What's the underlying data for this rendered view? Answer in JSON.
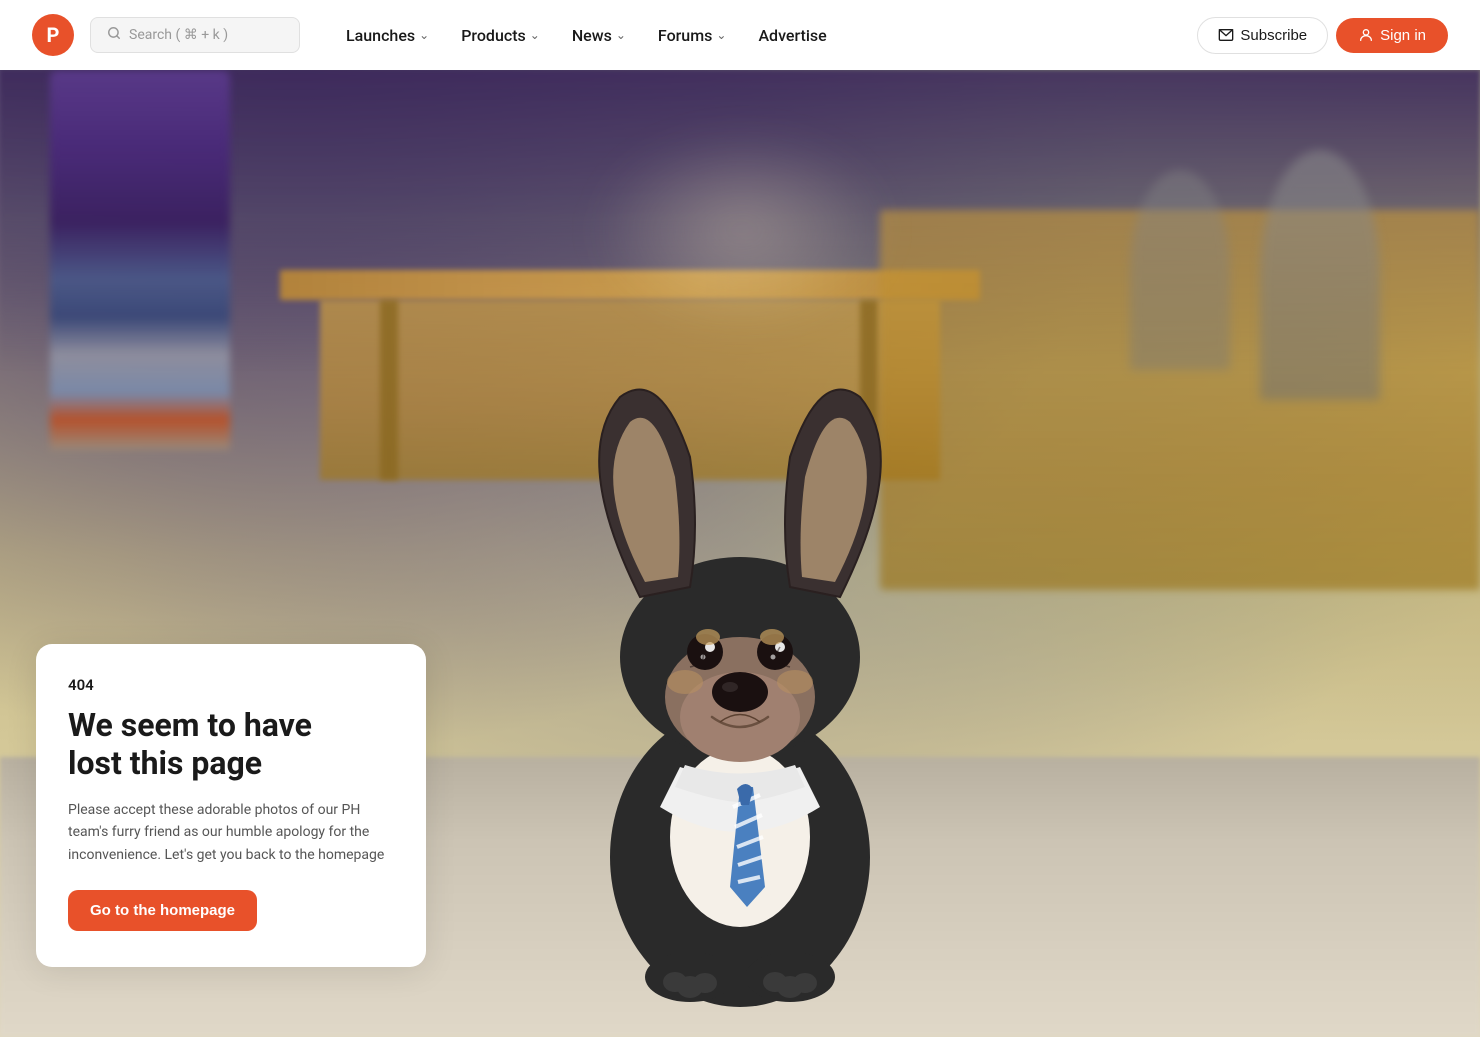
{
  "nav": {
    "logo_letter": "P",
    "search_placeholder": "Search ( ⌘ + k )",
    "links": [
      {
        "label": "Launches",
        "has_chevron": true
      },
      {
        "label": "Products",
        "has_chevron": true
      },
      {
        "label": "News",
        "has_chevron": true
      },
      {
        "label": "Forums",
        "has_chevron": true
      },
      {
        "label": "Advertise",
        "has_chevron": false
      }
    ],
    "subscribe_label": "Subscribe",
    "signin_label": "Sign in"
  },
  "error_page": {
    "code": "404",
    "title_line1": "We seem to have",
    "title_line2": "lost this page",
    "description": "Please accept these adorable photos of our PH team's furry friend as our humble apology for the inconvenience. Let's get you back to the homepage",
    "cta_label": "Go to the homepage"
  },
  "colors": {
    "brand": "#e8512a",
    "text_dark": "#1a1a1a",
    "text_muted": "#555555",
    "border": "#e0e0e0",
    "bg_light": "#f5f5f5",
    "white": "#ffffff"
  },
  "icons": {
    "search": "🔍",
    "envelope": "✉",
    "user_circle": "👤",
    "chevron_down": "›"
  }
}
